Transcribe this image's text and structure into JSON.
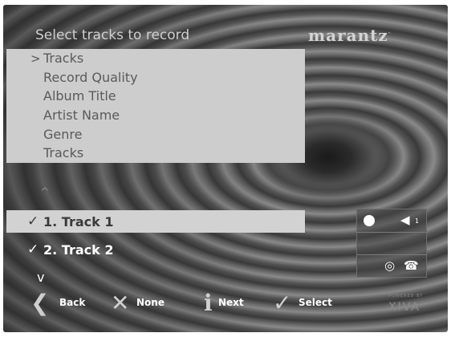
{
  "header": {
    "title": "Select tracks to record"
  },
  "brand": {
    "logo": "marantz",
    "logo_mark": "·",
    "footer_brand": "XIVA",
    "footer_brand_tagline": "POWERED BY"
  },
  "menu": {
    "items": [
      {
        "label": "Tracks",
        "selected": true
      },
      {
        "label": "Record Quality",
        "selected": false
      },
      {
        "label": "Album Title",
        "selected": false
      },
      {
        "label": "Artist Name",
        "selected": false
      },
      {
        "label": "Genre",
        "selected": false
      },
      {
        "label": "Tracks",
        "selected": false
      }
    ],
    "cursor_glyph": ">"
  },
  "list": {
    "scroll_up_glyph": "^",
    "scroll_down_glyph": "v",
    "check_glyph": "✓",
    "tracks": [
      {
        "label": "1. Track 1",
        "checked": true,
        "highlighted": true
      },
      {
        "label": "2. Track 2",
        "checked": true,
        "highlighted": false
      }
    ]
  },
  "status": {
    "record_icon": "record-dot-icon",
    "volume_icon": "speaker-icon",
    "volume_glyph": "◀",
    "volume_level": "1",
    "disc_icon": "disc-icon",
    "disc_glyph": "◎",
    "phone_icon": "phone-icon",
    "phone_glyph": "☎"
  },
  "footer": {
    "buttons": [
      {
        "label": "Back",
        "icon": "back-arrow-icon",
        "glyph": "❮"
      },
      {
        "label": "None",
        "icon": "x-icon",
        "glyph": "✕"
      },
      {
        "label": "Next",
        "icon": "info-icon",
        "glyph": "i"
      },
      {
        "label": "Select",
        "icon": "check-icon",
        "glyph": "✓"
      }
    ]
  }
}
